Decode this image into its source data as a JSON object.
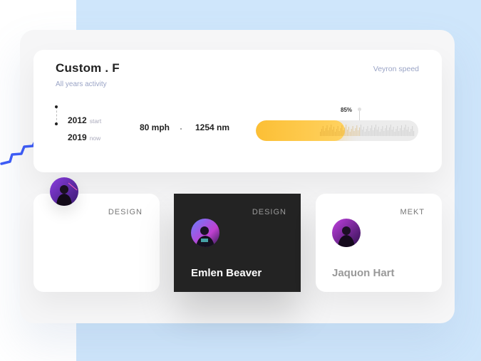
{
  "header": {
    "title": "Custom . F",
    "subtitle": "All years activity",
    "right_label": "Veyron speed"
  },
  "timeline": [
    {
      "year": "2012",
      "label": "start"
    },
    {
      "year": "2019",
      "label": "now"
    }
  ],
  "stats": {
    "speed": "80 mph",
    "distance": "1254 nm"
  },
  "progress": {
    "value": 0.85,
    "label": "85%",
    "colors": {
      "fill_start": "#fcbf35",
      "fill_end": "#ffd260",
      "track": "#ececec"
    }
  },
  "cards": [
    {
      "tag": "DESIGN",
      "name": ""
    },
    {
      "tag": "DESIGN",
      "name": "Emlen Beaver"
    },
    {
      "tag": "MEKT",
      "name": "Jaquon Hart"
    }
  ],
  "icons": {
    "squiggle": "squiggle-decoration",
    "avatar": "avatar-photo"
  },
  "colors": {
    "accent_blue": "#3d5cf5",
    "page_bg": "#cfe6fb",
    "dark_card": "#232323"
  }
}
